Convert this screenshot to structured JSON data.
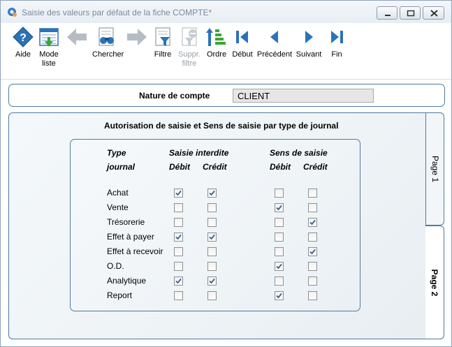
{
  "window": {
    "title": "Saisie des valeurs par défaut de la fiche COMPTE*",
    "controls": [
      "minimize",
      "maximize",
      "close"
    ]
  },
  "toolbar": {
    "buttons": [
      {
        "label": "Aide",
        "icon": "help-icon",
        "enabled": true
      },
      {
        "label": "Mode\nliste",
        "icon": "list-mode-icon",
        "enabled": true
      },
      {
        "label": "",
        "icon": "arrow-left-icon",
        "enabled": false
      },
      {
        "label": "Chercher",
        "icon": "binoculars-icon",
        "enabled": true
      },
      {
        "label": "",
        "icon": "arrow-right-icon",
        "enabled": false
      },
      {
        "label": "Filtre",
        "icon": "filter-icon",
        "enabled": true
      },
      {
        "label": "Suppr.\nfiltre",
        "icon": "remove-filter-icon",
        "enabled": false
      },
      {
        "label": "Ordre",
        "icon": "sort-icon",
        "enabled": true
      },
      {
        "label": "Début",
        "icon": "first-icon",
        "enabled": true
      },
      {
        "label": "Précédent",
        "icon": "previous-icon",
        "enabled": true
      },
      {
        "label": "Suivant",
        "icon": "next-icon",
        "enabled": true
      },
      {
        "label": "Fin",
        "icon": "last-icon",
        "enabled": true
      }
    ]
  },
  "header": {
    "label": "Nature de compte",
    "value": "CLIENT"
  },
  "panel": {
    "title": "Autorisation de saisie et Sens de saisie par type de journal",
    "col_type_1": "Type",
    "col_type_2": "journal",
    "group1": "Saisie interdite",
    "group2": "Sens de saisie",
    "debit": "Débit",
    "credit": "Crédit",
    "rows": [
      {
        "label": "Achat",
        "values": [
          true,
          true,
          false,
          false
        ]
      },
      {
        "label": "Vente",
        "values": [
          false,
          false,
          true,
          false
        ]
      },
      {
        "label": "Trésorerie",
        "values": [
          false,
          false,
          false,
          true
        ]
      },
      {
        "label": "Effet à payer",
        "values": [
          true,
          true,
          false,
          false
        ]
      },
      {
        "label": "Effet à recevoir",
        "values": [
          false,
          false,
          false,
          true
        ]
      },
      {
        "label": "O.D.",
        "values": [
          false,
          false,
          true,
          false
        ]
      },
      {
        "label": "Analytique",
        "values": [
          true,
          true,
          false,
          false
        ]
      },
      {
        "label": "Report",
        "values": [
          false,
          false,
          true,
          false
        ]
      }
    ]
  },
  "tabs": [
    {
      "label": "Page 1",
      "active": false
    },
    {
      "label": "Page 2",
      "active": true
    }
  ],
  "colors": {
    "accent": "#2a73b8",
    "border": "#4f7a9e",
    "green": "#3aa635"
  }
}
